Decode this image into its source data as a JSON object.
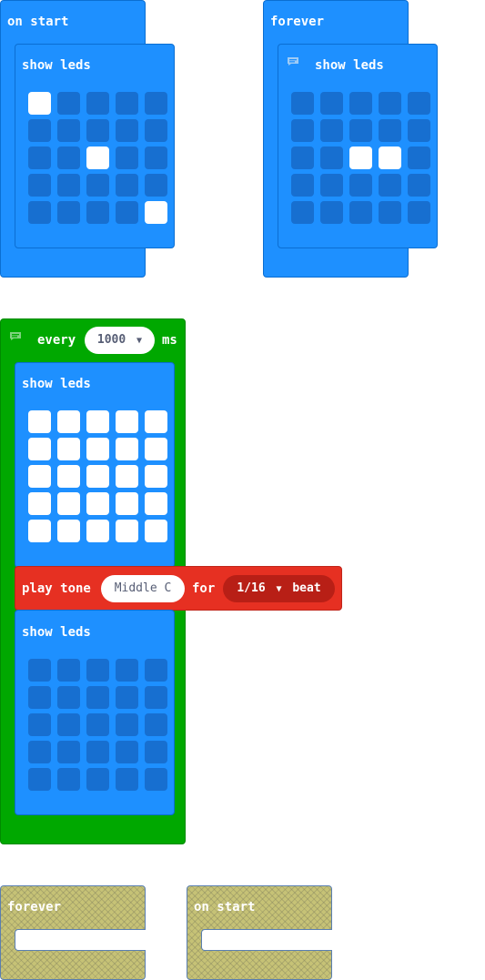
{
  "blocks": {
    "on_start_1": {
      "label": "on start",
      "inner": {
        "label": "show leds"
      },
      "leds": [
        [
          1,
          0,
          0,
          0,
          0
        ],
        [
          0,
          0,
          0,
          0,
          0
        ],
        [
          0,
          0,
          1,
          0,
          0
        ],
        [
          0,
          0,
          0,
          0,
          0
        ],
        [
          0,
          0,
          0,
          0,
          1
        ]
      ]
    },
    "forever_1": {
      "label": "forever",
      "inner": {
        "label": "show leds",
        "comment_icon": "comment-icon"
      },
      "leds": [
        [
          0,
          0,
          0,
          0,
          0
        ],
        [
          0,
          0,
          0,
          0,
          0
        ],
        [
          0,
          0,
          1,
          1,
          0
        ],
        [
          0,
          0,
          0,
          0,
          0
        ],
        [
          0,
          0,
          0,
          0,
          0
        ]
      ]
    },
    "every": {
      "label": "every",
      "interval": "1000",
      "unit": "ms",
      "comment_icon": "comment-icon",
      "dropdown_icon": "triangle-down-icon",
      "show_leds_1": {
        "label": "show leds",
        "leds": [
          [
            1,
            1,
            1,
            1,
            1
          ],
          [
            1,
            1,
            1,
            1,
            1
          ],
          [
            1,
            1,
            1,
            1,
            1
          ],
          [
            1,
            1,
            1,
            1,
            1
          ],
          [
            1,
            1,
            1,
            1,
            1
          ]
        ]
      },
      "play_tone": {
        "label_play": "play tone",
        "note": "Middle C",
        "label_for": "for",
        "duration": "1/16",
        "duration_unit": "beat"
      },
      "show_leds_2": {
        "label": "show leds",
        "leds": [
          [
            0,
            0,
            0,
            0,
            0
          ],
          [
            0,
            0,
            0,
            0,
            0
          ],
          [
            0,
            0,
            0,
            0,
            0
          ],
          [
            0,
            0,
            0,
            0,
            0
          ],
          [
            0,
            0,
            0,
            0,
            0
          ]
        ]
      }
    },
    "forever_disabled": {
      "label": "forever"
    },
    "on_start_disabled": {
      "label": "on start"
    }
  },
  "colors": {
    "basic_blue": "#1e90ff",
    "loops_green": "#00a800",
    "music_red": "#e63022",
    "led_off": "#176fd0",
    "led_on": "#ffffff",
    "disabled": "#c6c276"
  }
}
